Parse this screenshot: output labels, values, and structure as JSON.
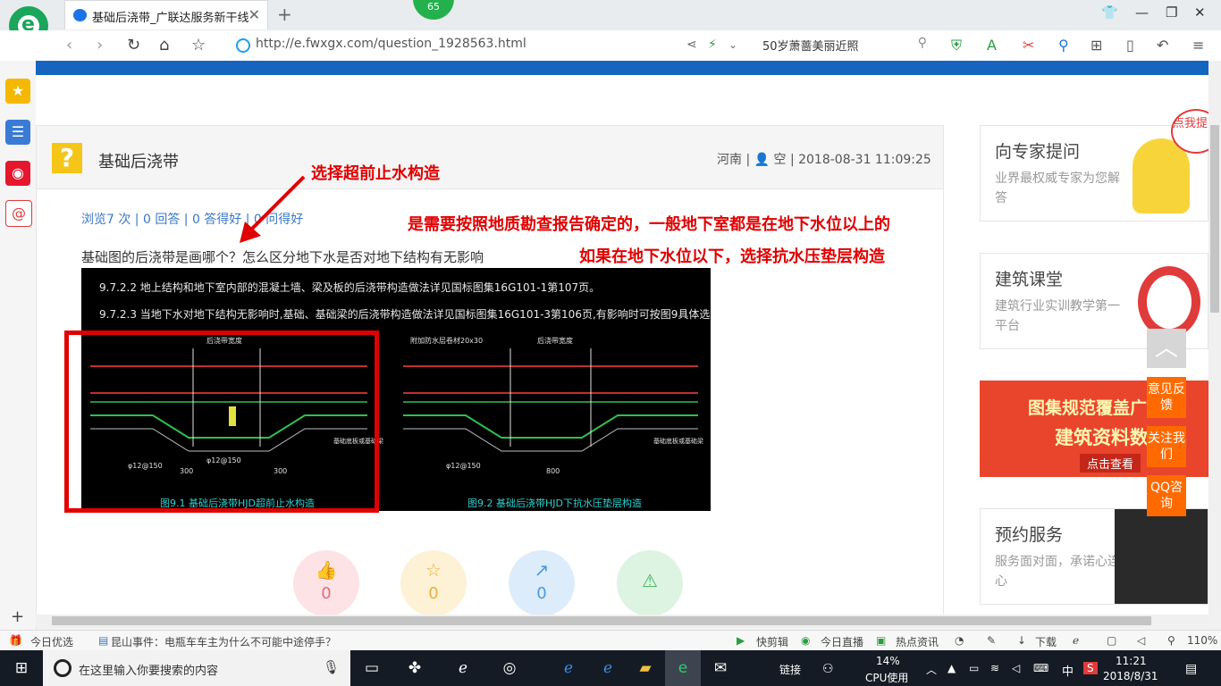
{
  "browser": {
    "tab_title": "基础后浇带_广联达服务新干线",
    "tab_close": "✕",
    "new_tab": "+",
    "badge_count": "65",
    "url": "http://e.fwxgx.com/question_1928563.html",
    "search_text": "50岁萧蔷美丽近照",
    "zoom": "110%"
  },
  "question": {
    "title": "基础后浇带",
    "meta": "河南 | 👤 空 | 2018-08-31 11:09:25",
    "stats": "浏览7 次 | 0 回答 | 0 答得好 | 0 问得好",
    "body": "基础图的后浇带是画哪个？怎么区分地下水是否对地下结构有无影响",
    "cad_line1": "9.7.2.2  地上结构和地下室内部的混凝土墙、梁及板的后浇带构造做法详见国标图集16G101-1第107页。",
    "cad_line2": "9.7.2.3  当地下水对地下结构无影响时,基础、基础梁的后浇带构造做法详见国标图集16G101-3第106页,有影响时可按图9具体选用。",
    "cad_caption1": "图9.1   基础后浇带HJD超前止水构造",
    "cad_caption2": "图9.2   基础后浇带HJD下抗水压垫层构造",
    "cad_label_a": "后浇带宽度",
    "cad_label_b": "φ12@150",
    "cad_label_c": "300",
    "cad_label_d": "800",
    "cad_label_e": "附加防水层卷材20x30",
    "cad_label_f": "基础底板或基础梁",
    "actions": [
      {
        "icon": "👍",
        "count": "0"
      },
      {
        "icon": "☆",
        "count": "0"
      },
      {
        "icon": "↗",
        "count": "0"
      },
      {
        "icon": "⚠",
        "count": ""
      }
    ]
  },
  "annotations": {
    "a1": "选择超前止水构造",
    "a2": "是需要按照地质勘查报告确定的，一般地下室都是在地下水位以上的",
    "a3": "如果在地下水位以下，选择抗水压垫层构造"
  },
  "right": {
    "card1_title": "向专家提问",
    "card1_sub": "业界最权威专家为您解答",
    "card2_title": "建筑课堂",
    "card2_sub": "建筑行业实训教学第一平台",
    "banner_line1": "图集规范覆盖广",
    "banner_line2": "建筑资料数",
    "banner_btn": "点击查看",
    "card4_title": "预约服务",
    "card4_sub": "服务面对面，承诺心连心",
    "corner_tip": "点我提问"
  },
  "float_buttons": {
    "feedback": "意见反馈",
    "follow": "关注我们",
    "qq": "QQ咨询"
  },
  "status_bar": {
    "today": "今日优选",
    "news": "昆山事件：电瓶车车主为什么不可能中途停手？",
    "quickcut": "快剪辑",
    "live": "今日直播",
    "hot": "热点资讯",
    "download": "下载"
  },
  "taskbar": {
    "search_placeholder": "在这里输入你要搜索的内容",
    "link": "链接",
    "cpu": "14%",
    "cpu_label": "CPU使用",
    "lang": "中",
    "time": "11:21",
    "date": "2018/8/31"
  }
}
